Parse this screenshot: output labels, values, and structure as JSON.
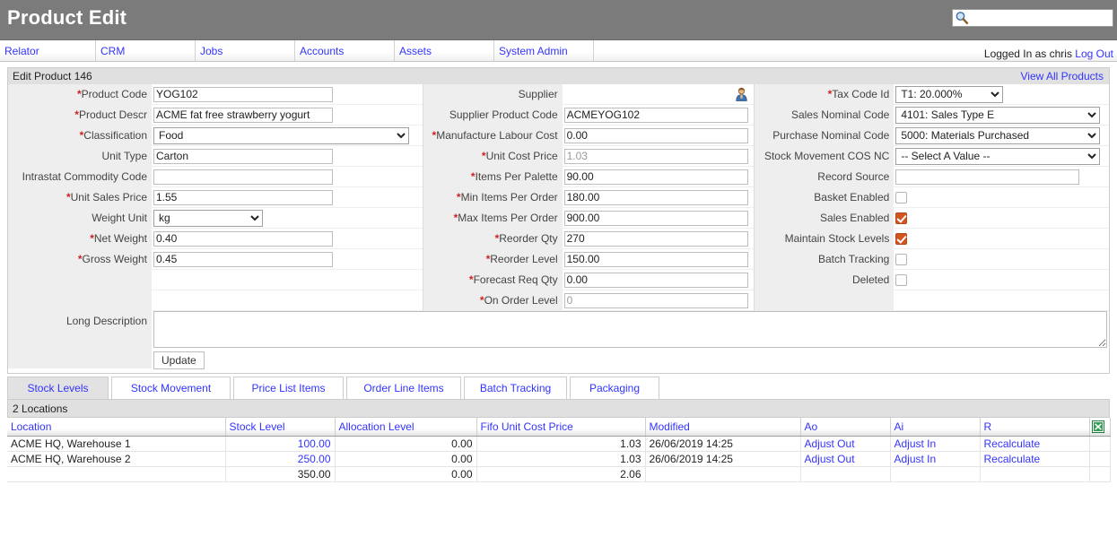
{
  "header": {
    "app_title": "Product Edit",
    "search_placeholder": "",
    "search_value": "",
    "search_icon": "search-icon"
  },
  "nav": {
    "items": [
      {
        "label": "Relator"
      },
      {
        "label": "CRM"
      },
      {
        "label": "Jobs"
      },
      {
        "label": "Accounts"
      },
      {
        "label": "Assets"
      },
      {
        "label": "System Admin"
      }
    ],
    "logged_in_text": "Logged In as chris",
    "logout_label": "Log Out"
  },
  "section": {
    "title": "Edit Product 146",
    "view_all_label": "View All Products"
  },
  "form": {
    "col_left": {
      "product_code": {
        "label": "Product Code",
        "required": true,
        "value": "YOG102"
      },
      "product_descr": {
        "label": "Product Descr",
        "required": true,
        "value": "ACME fat free strawberry yogurt"
      },
      "classification": {
        "label": "Classification",
        "required": true,
        "value": "Food"
      },
      "unit_type": {
        "label": "Unit Type",
        "required": false,
        "value": "Carton"
      },
      "intrastat_commodity_code": {
        "label": "Intrastat Commodity Code",
        "required": false,
        "value": ""
      },
      "unit_sales_price": {
        "label": "Unit Sales Price",
        "required": true,
        "value": "1.55"
      },
      "weight_unit": {
        "label": "Weight Unit",
        "required": false,
        "value": "kg"
      },
      "net_weight": {
        "label": "Net Weight",
        "required": true,
        "value": "0.40"
      },
      "gross_weight": {
        "label": "Gross Weight",
        "required": true,
        "value": "0.45"
      }
    },
    "col_mid": {
      "supplier": {
        "label": "Supplier",
        "required": false,
        "value": "",
        "icon": "supplier-person-icon"
      },
      "supplier_product_code": {
        "label": "Supplier Product Code",
        "required": false,
        "value": "ACMEYOG102"
      },
      "manufacture_labour_cost": {
        "label": "Manufacture Labour Cost",
        "required": true,
        "value": "0.00"
      },
      "unit_cost_price": {
        "label": "Unit Cost Price",
        "required": true,
        "value": "1.03",
        "readonly": true
      },
      "items_per_palette": {
        "label": "Items Per Palette",
        "required": true,
        "value": "90.00"
      },
      "min_items_per_order": {
        "label": "Min Items Per Order",
        "required": true,
        "value": "180.00"
      },
      "max_items_per_order": {
        "label": "Max Items Per Order",
        "required": true,
        "value": "900.00"
      },
      "reorder_qty": {
        "label": "Reorder Qty",
        "required": true,
        "value": "270"
      },
      "reorder_level": {
        "label": "Reorder Level",
        "required": true,
        "value": "150.00"
      },
      "forecast_req_qty": {
        "label": "Forecast Req Qty",
        "required": true,
        "value": "0.00"
      },
      "on_order_level": {
        "label": "On Order Level",
        "required": true,
        "value": "0",
        "readonly": true
      }
    },
    "col_right": {
      "tax_code_id": {
        "label": "Tax Code Id",
        "required": true,
        "value": "T1: 20.000%"
      },
      "sales_nominal_code": {
        "label": "Sales Nominal Code",
        "required": false,
        "value": "4101: Sales Type E"
      },
      "purchase_nominal_code": {
        "label": "Purchase Nominal Code",
        "required": false,
        "value": "5000: Materials Purchased"
      },
      "stock_movement_cos_nc": {
        "label": "Stock Movement COS NC",
        "required": false,
        "value": "-- Select A Value --"
      },
      "record_source": {
        "label": "Record Source",
        "required": false,
        "value": ""
      },
      "basket_enabled": {
        "label": "Basket Enabled",
        "checked": false
      },
      "sales_enabled": {
        "label": "Sales Enabled",
        "checked": true
      },
      "maintain_stock_levels": {
        "label": "Maintain Stock Levels",
        "checked": true
      },
      "batch_tracking": {
        "label": "Batch Tracking",
        "checked": false
      },
      "deleted": {
        "label": "Deleted",
        "checked": false
      }
    },
    "long_description": {
      "label": "Long Description",
      "value": ""
    },
    "update_label": "Update"
  },
  "tabs": [
    {
      "label": "Stock Levels",
      "active": true
    },
    {
      "label": "Stock Movement",
      "active": false
    },
    {
      "label": "Price List Items",
      "active": false
    },
    {
      "label": "Order Line Items",
      "active": false
    },
    {
      "label": "Batch Tracking",
      "active": false
    },
    {
      "label": "Packaging",
      "active": false
    }
  ],
  "grid": {
    "title": "2 Locations",
    "columns": [
      "Location",
      "Stock Level",
      "Allocation Level",
      "Fifo Unit Cost Price",
      "Modified",
      "Ao",
      "Ai",
      "R",
      ""
    ],
    "export_icon": "excel-export-icon",
    "rows": [
      {
        "location": "ACME HQ, Warehouse 1",
        "stock_level": "100.00",
        "stock_level_link": true,
        "allocation_level": "0.00",
        "fifo_unit_cost_price": "1.03",
        "modified": "26/06/2019 14:25",
        "ao": "Adjust Out",
        "ai": "Adjust In",
        "r": "Recalculate"
      },
      {
        "location": "ACME HQ, Warehouse 2",
        "stock_level": "250.00",
        "stock_level_link": true,
        "allocation_level": "0.00",
        "fifo_unit_cost_price": "1.03",
        "modified": "26/06/2019 14:25",
        "ao": "Adjust Out",
        "ai": "Adjust In",
        "r": "Recalculate"
      }
    ],
    "totals": {
      "location": "",
      "stock_level": "350.00",
      "allocation_level": "0.00",
      "fifo_unit_cost_price": "2.06",
      "modified": "",
      "ao": "",
      "ai": "",
      "r": ""
    }
  },
  "colors": {
    "header_bg": "#7b7b7b",
    "link": "#3333ff",
    "required_star": "#d02020",
    "checkbox_on": "#d2541f",
    "panel_label_bg": "#eeeeee"
  }
}
